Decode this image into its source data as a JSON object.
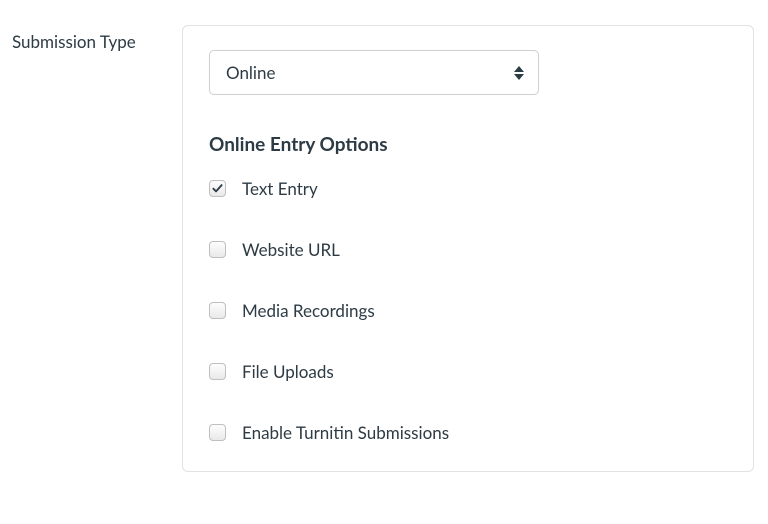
{
  "label": "Submission Type",
  "select": {
    "value": "Online"
  },
  "section_heading": "Online Entry Options",
  "options": [
    {
      "label": "Text Entry",
      "checked": true
    },
    {
      "label": "Website URL",
      "checked": false
    },
    {
      "label": "Media Recordings",
      "checked": false
    },
    {
      "label": "File Uploads",
      "checked": false
    },
    {
      "label": "Enable Turnitin Submissions",
      "checked": false
    }
  ]
}
